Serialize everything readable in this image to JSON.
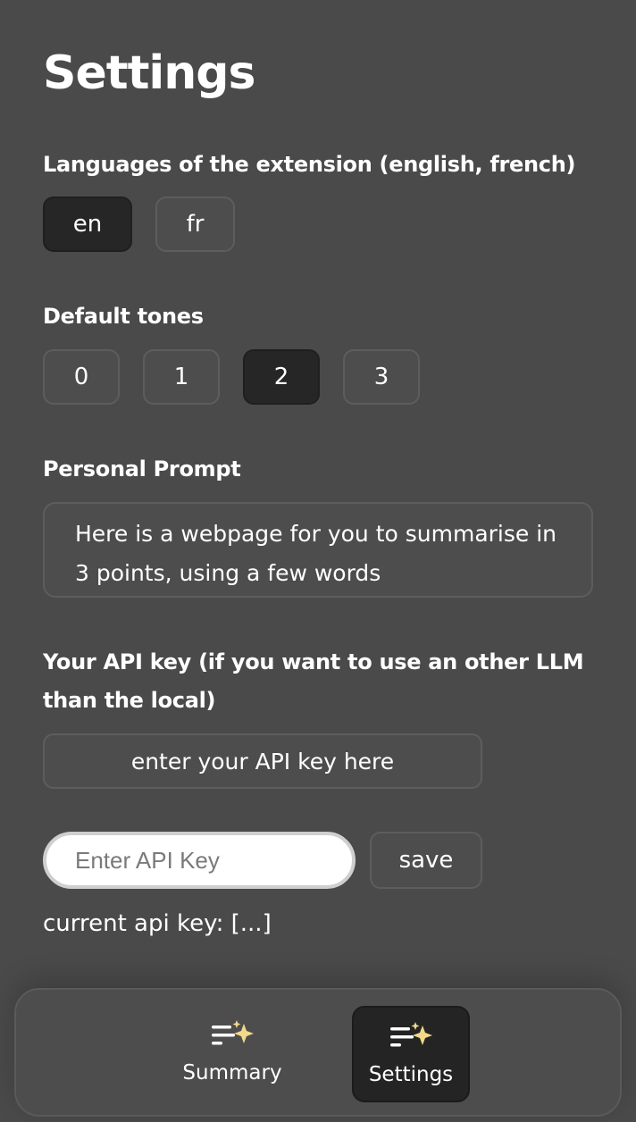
{
  "page": {
    "title": "Settings"
  },
  "languages": {
    "label": "Languages of the extension (english, french)",
    "options": [
      "en",
      "fr"
    ],
    "selected": "en"
  },
  "tones": {
    "label": "Default tones",
    "options": [
      "0",
      "1",
      "2",
      "3"
    ],
    "selected": "2"
  },
  "prompt": {
    "label": "Personal Prompt",
    "value": "Here is a webpage for you to summarise in 3 points, using a few words"
  },
  "api": {
    "label_line1": "Your API key (if you want to use an other LLM",
    "label_line2": "than the local)",
    "button_label": "enter your API key here",
    "input_placeholder": "Enter API Key",
    "save_label": "save",
    "current_key": "current api key: [...]"
  },
  "nav": {
    "items": [
      {
        "label": "Summary",
        "icon": "sparkle-lines-icon",
        "active": false
      },
      {
        "label": "Settings",
        "icon": "sparkle-lines-icon",
        "active": true
      }
    ]
  },
  "colors": {
    "background": "#4a4a4a",
    "button": "#4d4d4d",
    "button_active": "#262626",
    "sparkle": "#f2d98a"
  }
}
